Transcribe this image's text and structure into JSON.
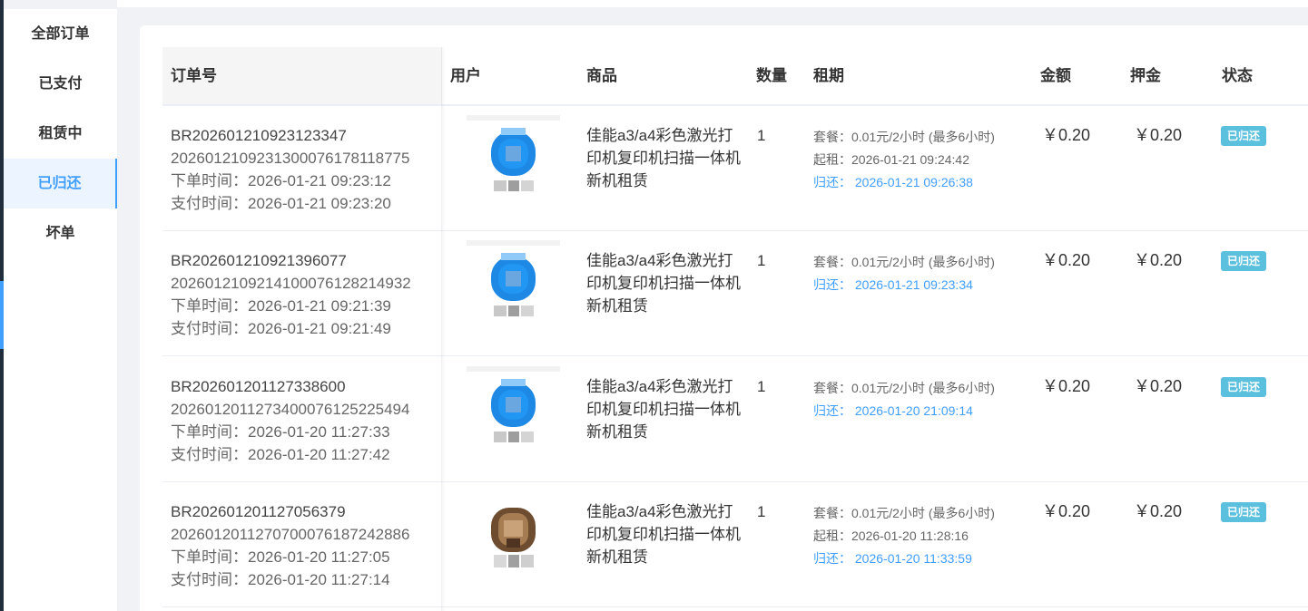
{
  "sidebar": {
    "items": [
      {
        "label": "全部订单",
        "active": false
      },
      {
        "label": "已支付",
        "active": false
      },
      {
        "label": "租赁中",
        "active": false
      },
      {
        "label": "已归还",
        "active": true
      },
      {
        "label": "坏单",
        "active": false
      }
    ]
  },
  "table": {
    "headers": {
      "order_no": "订单号",
      "user": "用户",
      "product": "商品",
      "quantity": "数量",
      "period": "租期",
      "amount": "金额",
      "deposit": "押金",
      "status": "状态"
    },
    "rows": [
      {
        "order_no": "BR202601210923123347",
        "trade_no": "2026012109231300076178118775",
        "order_time": "下单时间：2026-01-21 09:23:12",
        "pay_time": "支付时间：2026-01-21 09:23:20",
        "avatar": "blue-avatar-icon",
        "product": "佳能a3/a4彩色激光打印机复印机扫描一体机新机租赁",
        "quantity": "1",
        "plan": "套餐：0.01元/2小时 (最多6小时)",
        "start": "起租：2026-01-21 09:24:42",
        "return": "归还：  2026-01-21 09:26:38",
        "amount": "￥0.20",
        "deposit": "￥0.20",
        "status": "已归还"
      },
      {
        "order_no": "BR202601210921396077",
        "trade_no": "2026012109214100076128214932",
        "order_time": "下单时间：2026-01-21 09:21:39",
        "pay_time": "支付时间：2026-01-21 09:21:49",
        "avatar": "blue-avatar-icon",
        "product": "佳能a3/a4彩色激光打印机复印机扫描一体机新机租赁",
        "quantity": "1",
        "plan": "套餐：0.01元/2小时 (最多6小时)",
        "return": "归还：  2026-01-21 09:23:34",
        "amount": "￥0.20",
        "deposit": "￥0.20",
        "status": "已归还"
      },
      {
        "order_no": "BR202601201127338600",
        "trade_no": "2026012011273400076125225494",
        "order_time": "下单时间：2026-01-20 11:27:33",
        "pay_time": "支付时间：2026-01-20 11:27:42",
        "avatar": "blue-avatar-icon",
        "product": "佳能a3/a4彩色激光打印机复印机扫描一体机新机租赁",
        "quantity": "1",
        "plan": "套餐：0.01元/2小时 (最多6小时)",
        "return": "归还：  2026-01-20 21:09:14",
        "amount": "￥0.20",
        "deposit": "￥0.20",
        "status": "已归还"
      },
      {
        "order_no": "BR202601201127056379",
        "trade_no": "2026012011270700076187242886",
        "order_time": "下单时间：2026-01-20 11:27:05",
        "pay_time": "支付时间：2026-01-20 11:27:14",
        "avatar": "brown-avatar-icon",
        "product": "佳能a3/a4彩色激光打印机复印机扫描一体机新机租赁",
        "quantity": "1",
        "plan": "套餐：0.01元/2小时 (最多6小时)",
        "start": "起租：2026-01-20 11:28:16",
        "return": "归还：  2026-01-20 11:33:59",
        "amount": "￥0.20",
        "deposit": "￥0.20",
        "status": "已归还"
      }
    ]
  },
  "colors": {
    "accent": "#409eff",
    "badge": "#5bc0de",
    "sidebar_dark": "#1f2d3d"
  }
}
